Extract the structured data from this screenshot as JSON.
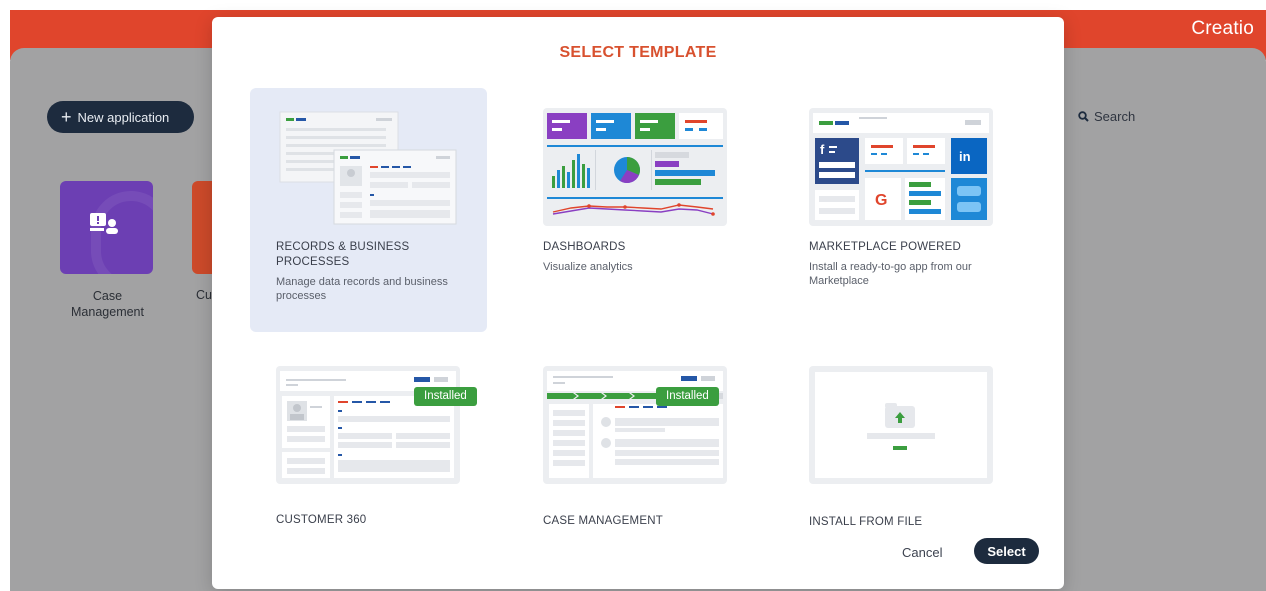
{
  "app": {
    "brand": "Creatio",
    "new_app_label": "New application",
    "search_label": "Search",
    "tiles": [
      {
        "label": "Case Management",
        "color": "#6c3fb3"
      },
      {
        "label": "Cu",
        "color": "#cc4a2a"
      }
    ]
  },
  "modal": {
    "title": "SELECT TEMPLATE",
    "templates": [
      {
        "name": "RECORDS & BUSINESS PROCESSES",
        "description": "Manage data records and business processes",
        "selected": true
      },
      {
        "name": "DASHBOARDS",
        "description": "Visualize analytics"
      },
      {
        "name": "MARKETPLACE POWERED",
        "description": "Install a ready-to-go app from our Marketplace"
      },
      {
        "name": "CUSTOMER 360",
        "badge": "Installed"
      },
      {
        "name": "CASE MANAGEMENT",
        "badge": "Installed"
      },
      {
        "name": "INSTALL FROM FILE"
      }
    ],
    "cancel_label": "Cancel",
    "select_label": "Select"
  },
  "colors": {
    "header": "#e0452c",
    "accent_title": "#d8512f",
    "primary_button": "#1d2b3e",
    "selected_card": "#e5eaf6",
    "badge": "#3b9e3f"
  }
}
